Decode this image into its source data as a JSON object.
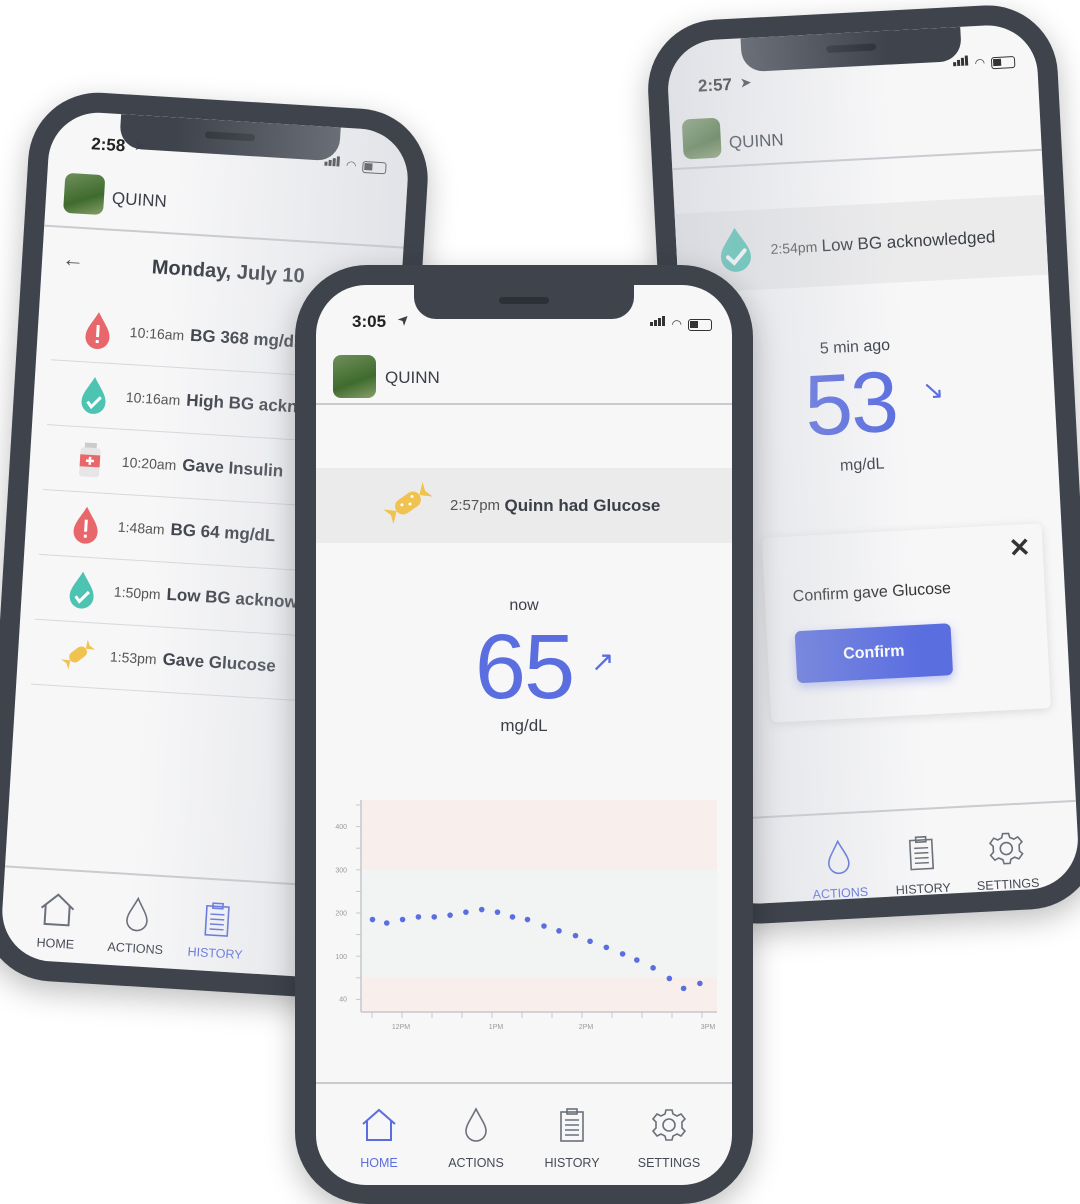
{
  "colors": {
    "accent": "#5b6ee0",
    "alert_red": "#e8676b",
    "check_teal": "#4dc3b2",
    "candy": "#f0c250",
    "bezel": "#3e434c",
    "high_band": "#f8efed",
    "low_band": "#f8efed",
    "normal_band": "#f2f3f3"
  },
  "left_phone": {
    "status_time": "2:58",
    "user_name": "QUINN",
    "date_title": "Monday, July 10",
    "history": [
      {
        "icon": "alert-drop-icon",
        "time": "10:16am",
        "text": "BG 368 mg/dL"
      },
      {
        "icon": "check-drop-icon",
        "time": "10:16am",
        "text": "High BG acknowl"
      },
      {
        "icon": "insulin-vial-icon",
        "time": "10:20am",
        "text": "Gave Insulin"
      },
      {
        "icon": "alert-drop-icon",
        "time": "1:48am",
        "text": "BG 64 mg/dL"
      },
      {
        "icon": "check-drop-icon",
        "time": "1:50pm",
        "text": "Low BG acknowle"
      },
      {
        "icon": "candy-icon",
        "time": "1:53pm",
        "text": "Gave Glucose"
      }
    ],
    "nav": [
      {
        "label": "HOME",
        "icon": "home-icon"
      },
      {
        "label": "ACTIONS",
        "icon": "drop-icon"
      },
      {
        "label": "HISTORY",
        "icon": "clipboard-icon",
        "active": true
      }
    ]
  },
  "center_phone": {
    "status_time": "3:05",
    "user_name": "QUINN",
    "banner": {
      "time": "2:57pm",
      "text": "Quinn had Glucose",
      "icon": "candy-icon"
    },
    "reading_age": "now",
    "reading_value": "65",
    "trend_arrow": "↗",
    "unit": "mg/dL",
    "nav": [
      {
        "label": "HOME",
        "icon": "home-icon",
        "active": true
      },
      {
        "label": "ACTIONS",
        "icon": "drop-icon"
      },
      {
        "label": "HISTORY",
        "icon": "clipboard-icon"
      },
      {
        "label": "SETTINGS",
        "icon": "gear-icon"
      }
    ]
  },
  "right_phone": {
    "status_time": "2:57",
    "user_name": "QUINN",
    "banner": {
      "time": "2:54pm",
      "text": "Low BG acknowledged",
      "icon": "check-drop-icon"
    },
    "reading_age": "5 min ago",
    "reading_value": "53",
    "trend_arrow": "↘",
    "unit": "mg/dL",
    "confirm_card": {
      "title": "Confirm gave Glucose",
      "button": "Confirm"
    },
    "nav": [
      {
        "label": "ACTIONS",
        "icon": "drop-icon",
        "active": true
      },
      {
        "label": "HISTORY",
        "icon": "clipboard-icon"
      },
      {
        "label": "SETTINGS",
        "icon": "gear-icon"
      }
    ]
  },
  "chart_data": {
    "type": "scatter",
    "y_ticks": [
      40,
      100,
      200,
      300,
      400
    ],
    "x_ticks": [
      "12PM",
      "1PM",
      "2PM",
      "3PM"
    ],
    "high_threshold": 300,
    "low_threshold": 70,
    "grid": false,
    "x": [
      "11:42",
      "11:51",
      "12:01",
      "12:11",
      "12:21",
      "12:31",
      "12:41",
      "12:51",
      "1:01",
      "1:11",
      "1:21",
      "1:32",
      "1:42",
      "1:53",
      "2:02",
      "2:10",
      "2:18",
      "2:25",
      "2:33",
      "2:41",
      "2:48",
      "2:56"
    ],
    "y": [
      185,
      177,
      185,
      191,
      191,
      195,
      202,
      208,
      202,
      191,
      185,
      170,
      159,
      148,
      135,
      121,
      106,
      95,
      84,
      69,
      55,
      62
    ],
    "color": "#5b6ee0"
  }
}
